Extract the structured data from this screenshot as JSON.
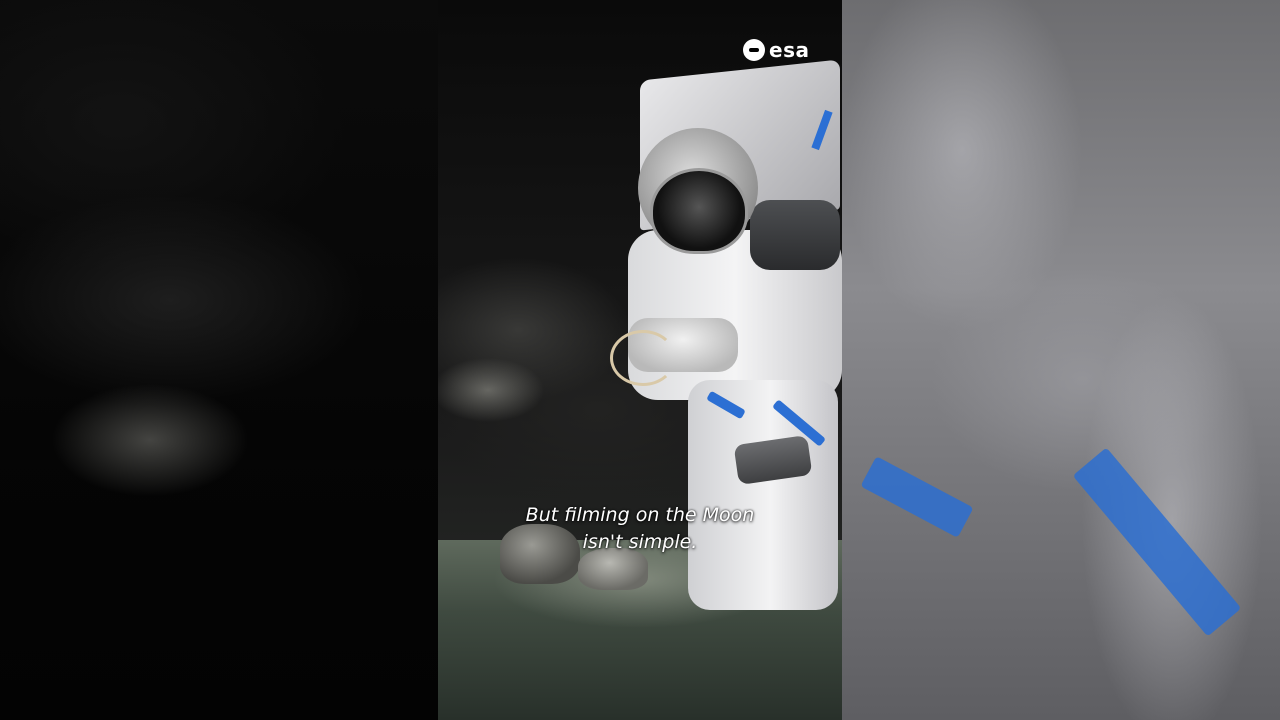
{
  "video": {
    "logo_text": "esa",
    "subtitle_lines": [
      "But filming on the Moon",
      "isn't simple."
    ]
  },
  "colors": {
    "suit_stripe": "#2d6fd0",
    "background": "#000000"
  }
}
